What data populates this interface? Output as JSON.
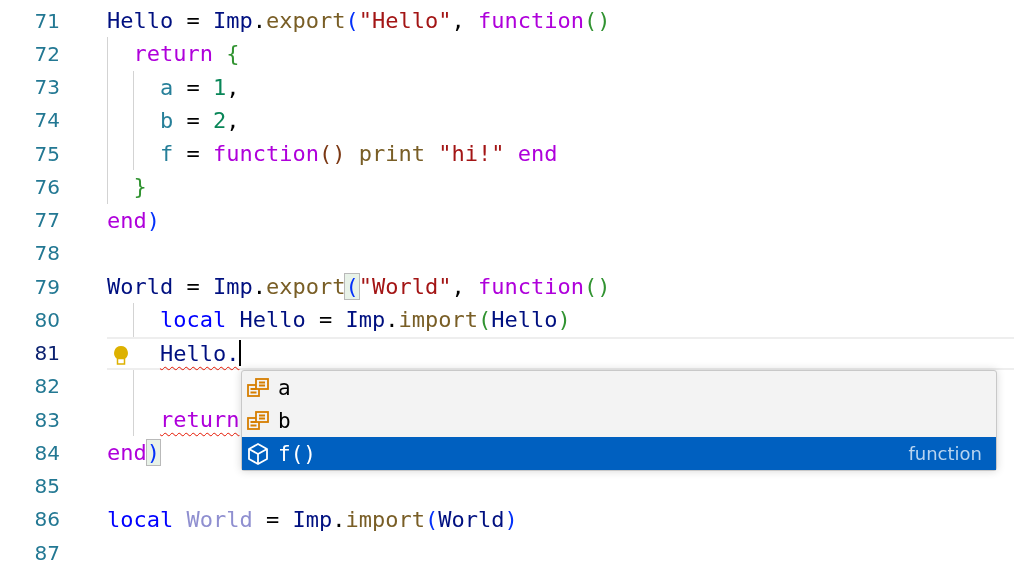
{
  "lines": [
    {
      "number": "71",
      "current": false,
      "cursor": false,
      "lightbulb": false,
      "tokens": [
        {
          "text": "Hello",
          "kind": "variable"
        },
        {
          "text": " = ",
          "kind": "punct"
        },
        {
          "text": "Imp",
          "kind": "variable"
        },
        {
          "text": ".",
          "kind": "punct"
        },
        {
          "text": "export",
          "kind": "function"
        },
        {
          "text": "(",
          "kind": "bracket1"
        },
        {
          "text": "\"Hello\"",
          "kind": "string"
        },
        {
          "text": ", ",
          "kind": "punct"
        },
        {
          "text": "function",
          "kind": "keyword"
        },
        {
          "text": "()",
          "kind": "bracket2"
        }
      ]
    },
    {
      "number": "72",
      "current": false,
      "cursor": false,
      "lightbulb": false,
      "indent": [
        {
          "guide": true
        }
      ],
      "tokens": [
        {
          "text": "return",
          "kind": "keyword"
        },
        {
          "text": " {",
          "kind": "bracket2"
        }
      ]
    },
    {
      "number": "73",
      "current": false,
      "cursor": false,
      "lightbulb": false,
      "indent": [
        {
          "guide": true
        },
        {
          "guide": true
        }
      ],
      "tokens": [
        {
          "text": "a",
          "kind": "field"
        },
        {
          "text": " = ",
          "kind": "punct"
        },
        {
          "text": "1",
          "kind": "number"
        },
        {
          "text": ",",
          "kind": "punct"
        }
      ]
    },
    {
      "number": "74",
      "current": false,
      "cursor": false,
      "lightbulb": false,
      "indent": [
        {
          "guide": true
        },
        {
          "guide": true
        }
      ],
      "tokens": [
        {
          "text": "b",
          "kind": "field"
        },
        {
          "text": " = ",
          "kind": "punct"
        },
        {
          "text": "2",
          "kind": "number"
        },
        {
          "text": ",",
          "kind": "punct"
        }
      ]
    },
    {
      "number": "75",
      "current": false,
      "cursor": false,
      "lightbulb": false,
      "indent": [
        {
          "guide": true
        },
        {
          "guide": true
        }
      ],
      "tokens": [
        {
          "text": "f",
          "kind": "field"
        },
        {
          "text": " = ",
          "kind": "punct"
        },
        {
          "text": "function",
          "kind": "keyword"
        },
        {
          "text": "()",
          "kind": "bracket3"
        },
        {
          "text": " print",
          "kind": "function"
        },
        {
          "text": " \"hi!\"",
          "kind": "string"
        },
        {
          "text": " end",
          "kind": "keyword"
        }
      ]
    },
    {
      "number": "76",
      "current": false,
      "cursor": false,
      "lightbulb": false,
      "indent": [
        {
          "guide": true
        }
      ],
      "tokens": [
        {
          "text": "}",
          "kind": "bracket2"
        }
      ]
    },
    {
      "number": "77",
      "current": false,
      "cursor": false,
      "lightbulb": false,
      "tokens": [
        {
          "text": "end",
          "kind": "keyword"
        },
        {
          "text": ")",
          "kind": "bracket1"
        }
      ]
    },
    {
      "number": "78",
      "current": false,
      "cursor": false,
      "lightbulb": false
    },
    {
      "number": "79",
      "current": false,
      "cursor": false,
      "lightbulb": false,
      "tokens": [
        {
          "text": "World",
          "kind": "variable"
        },
        {
          "text": " = ",
          "kind": "punct"
        },
        {
          "text": "Imp",
          "kind": "variable"
        },
        {
          "text": ".",
          "kind": "punct"
        },
        {
          "text": "export",
          "kind": "function"
        },
        {
          "text": "(",
          "kind": "bracket1",
          "matched": true
        },
        {
          "text": "\"World\"",
          "kind": "string"
        },
        {
          "text": ", ",
          "kind": "punct"
        },
        {
          "text": "function",
          "kind": "keyword"
        },
        {
          "text": "()",
          "kind": "bracket2"
        }
      ]
    },
    {
      "number": "80",
      "current": false,
      "cursor": false,
      "lightbulb": false,
      "indent": [
        {
          "guide": false
        },
        {
          "guide": true
        }
      ],
      "tokens": [
        {
          "text": "local",
          "kind": "local"
        },
        {
          "text": " Hello",
          "kind": "variable"
        },
        {
          "text": " = ",
          "kind": "punct"
        },
        {
          "text": "Imp",
          "kind": "variable"
        },
        {
          "text": ".",
          "kind": "punct"
        },
        {
          "text": "import",
          "kind": "function"
        },
        {
          "text": "(",
          "kind": "bracket2"
        },
        {
          "text": "Hello",
          "kind": "variable"
        },
        {
          "text": ")",
          "kind": "bracket2"
        }
      ]
    },
    {
      "number": "81",
      "current": true,
      "cursor": true,
      "lightbulb": true,
      "indent": [
        {
          "guide": false
        },
        {
          "guide": false
        }
      ],
      "tokens": [
        {
          "text": "Hello.",
          "kind": "variable",
          "error": true
        }
      ]
    },
    {
      "number": "82",
      "current": false,
      "cursor": false,
      "lightbulb": false,
      "indent": [
        {
          "guide": false
        },
        {
          "guide": true
        }
      ]
    },
    {
      "number": "83",
      "current": false,
      "cursor": false,
      "lightbulb": false,
      "indent": [
        {
          "guide": false
        },
        {
          "guide": true
        }
      ],
      "tokens": [
        {
          "text": "return",
          "kind": "keyword",
          "error": true
        }
      ]
    },
    {
      "number": "84",
      "current": false,
      "cursor": false,
      "lightbulb": false,
      "tokens": [
        {
          "text": "end",
          "kind": "keyword"
        },
        {
          "text": ")",
          "kind": "bracket1",
          "matched": true
        }
      ]
    },
    {
      "number": "85",
      "current": false,
      "cursor": false,
      "lightbulb": false
    },
    {
      "number": "86",
      "current": false,
      "cursor": false,
      "lightbulb": false,
      "tokens": [
        {
          "text": "local",
          "kind": "local"
        },
        {
          "text": " World",
          "kind": "unused"
        },
        {
          "text": " = ",
          "kind": "punct"
        },
        {
          "text": "Imp",
          "kind": "variable"
        },
        {
          "text": ".",
          "kind": "punct"
        },
        {
          "text": "import",
          "kind": "function"
        },
        {
          "text": "(",
          "kind": "bracket1"
        },
        {
          "text": "World",
          "kind": "variable"
        },
        {
          "text": ")",
          "kind": "bracket1"
        }
      ]
    },
    {
      "number": "87",
      "current": false,
      "cursor": false,
      "lightbulb": false
    }
  ],
  "suggestions": [
    {
      "kind": "field",
      "label": "a",
      "selected": false
    },
    {
      "kind": "field",
      "label": "b",
      "selected": false
    },
    {
      "kind": "method",
      "label": "f()",
      "detail": "function",
      "selected": true
    }
  ]
}
